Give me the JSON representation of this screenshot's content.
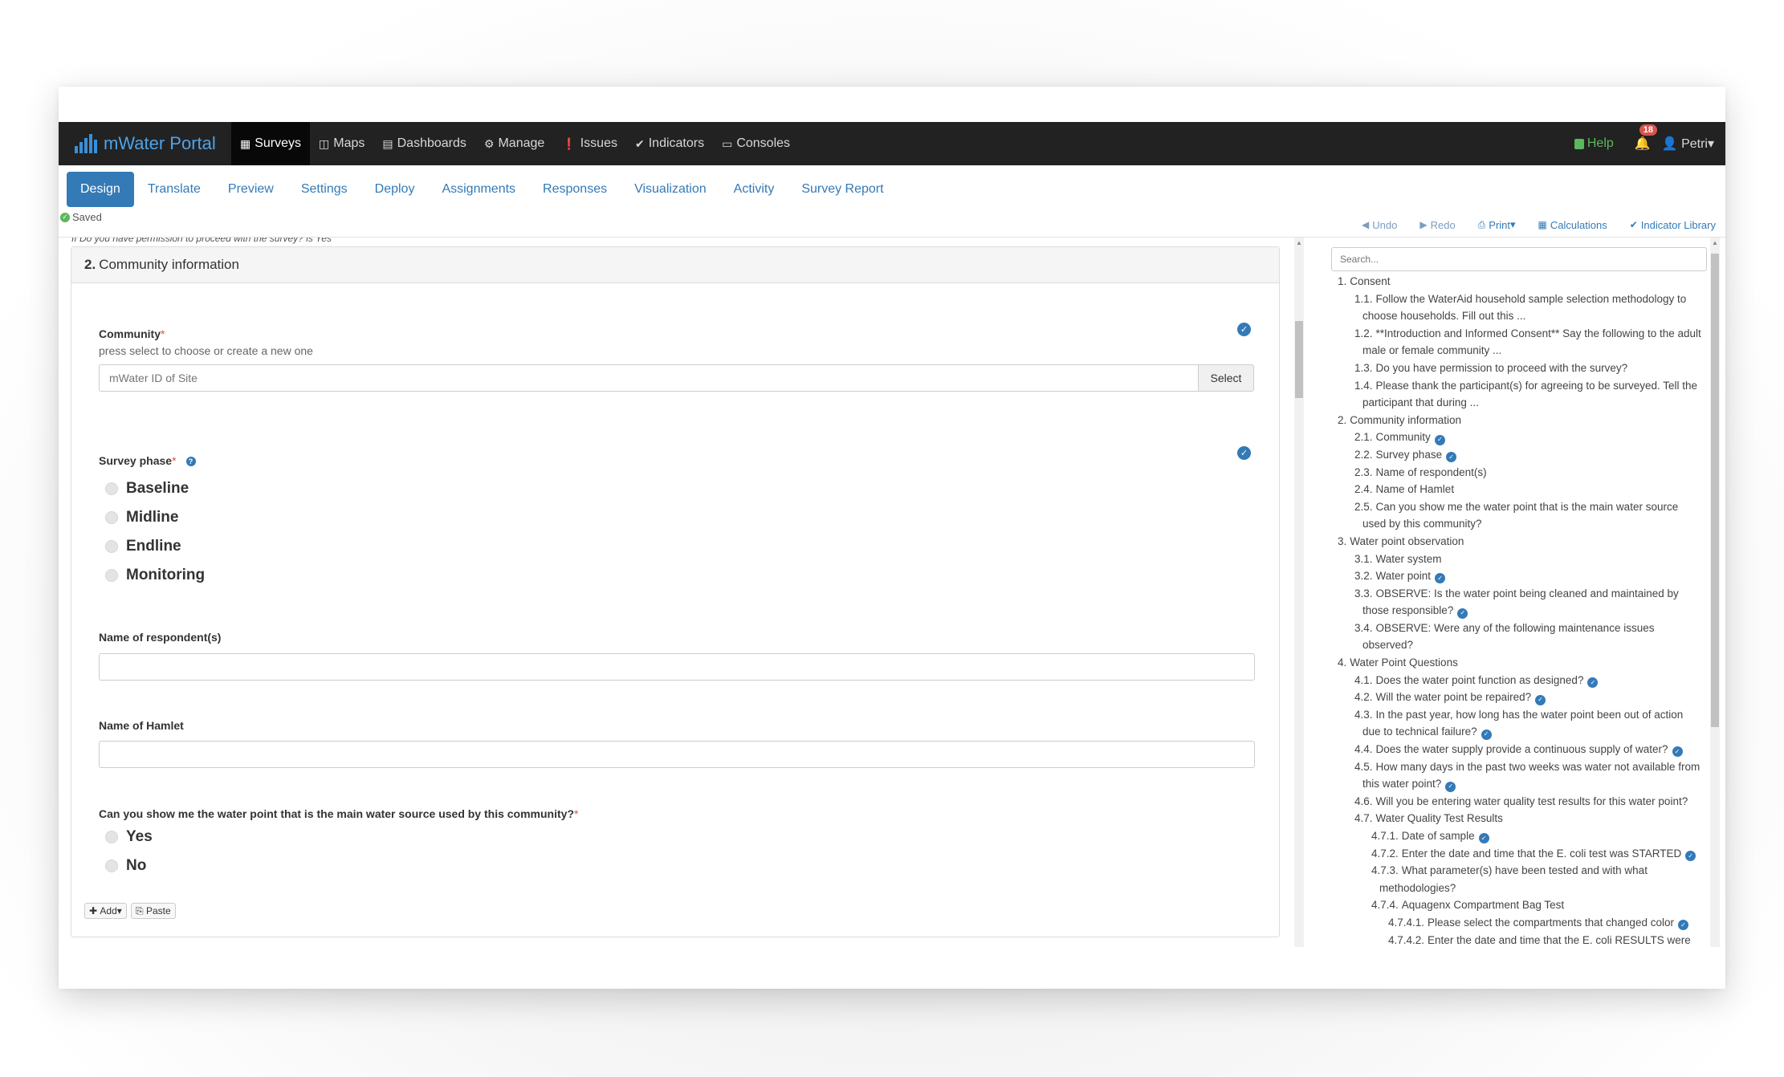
{
  "app": {
    "brand": "mWater Portal",
    "nav": [
      {
        "label": "Surveys",
        "icon": "table-icon"
      },
      {
        "label": "Maps",
        "icon": "map-icon"
      },
      {
        "label": "Dashboards",
        "icon": "bar-chart-icon"
      },
      {
        "label": "Manage",
        "icon": "gear-icon"
      },
      {
        "label": "Issues",
        "icon": "exclamation-icon"
      },
      {
        "label": "Indicators",
        "icon": "check-circle-icon"
      },
      {
        "label": "Consoles",
        "icon": "monitor-icon"
      }
    ],
    "help": "Help",
    "notifications_count": "18",
    "user": "Petri"
  },
  "tabs": [
    "Design",
    "Translate",
    "Preview",
    "Settings",
    "Deploy",
    "Assignments",
    "Responses",
    "Visualization",
    "Activity",
    "Survey Report"
  ],
  "status": "Saved",
  "toolbar": {
    "undo": "Undo",
    "redo": "Redo",
    "print": "Print",
    "calculations": "Calculations",
    "indicator_library": "Indicator Library"
  },
  "main": {
    "cut_text": "If Do you have permission to proceed with the survey? is Yes",
    "section": {
      "number": "2.",
      "title": "Community information"
    },
    "community": {
      "label": "Community",
      "hint": "press select to choose or create a new one",
      "placeholder": "mWater ID of Site",
      "select": "Select"
    },
    "phase": {
      "label": "Survey phase",
      "options": [
        "Baseline",
        "Midline",
        "Endline",
        "Monitoring"
      ]
    },
    "respondent": {
      "label": "Name of respondent(s)",
      "value": ""
    },
    "hamlet": {
      "label": "Name of Hamlet",
      "value": ""
    },
    "water_point": {
      "label": "Can you show me the water point that is the main water source used by this community?",
      "options": [
        "Yes",
        "No"
      ]
    },
    "add": "Add",
    "paste": "Paste"
  },
  "outline": {
    "search_placeholder": "Search...",
    "items": [
      {
        "n": "1.",
        "t": "Consent",
        "level": 1
      },
      {
        "n": "1.1.",
        "t": "Follow the WaterAid household sample selection methodology to",
        "t2": "choose households. Fill out this ...",
        "level": 2
      },
      {
        "n": "1.2.",
        "t": "**Introduction and Informed Consent** Say the following to the adult",
        "t2": "male or female community ...",
        "level": 2
      },
      {
        "n": "1.3.",
        "t": "Do you have permission to proceed with the survey?",
        "level": 2
      },
      {
        "n": "1.4.",
        "t": "Please thank the participant(s) for agreeing to be surveyed. Tell the",
        "t2": "participant that during ...",
        "level": 2
      },
      {
        "n": "2.",
        "t": "Community information",
        "level": 1
      },
      {
        "n": "2.1.",
        "t": "Community",
        "level": 2,
        "check": true
      },
      {
        "n": "2.2.",
        "t": "Survey phase",
        "level": 2,
        "check": true
      },
      {
        "n": "2.3.",
        "t": "Name of respondent(s)",
        "level": 2
      },
      {
        "n": "2.4.",
        "t": "Name of Hamlet",
        "level": 2
      },
      {
        "n": "2.5.",
        "t": "Can you show me the water point that is the main water source",
        "t2": "used by this community?",
        "level": 2
      },
      {
        "n": "3.",
        "t": "Water point observation",
        "level": 1
      },
      {
        "n": "3.1.",
        "t": "Water system",
        "level": 2
      },
      {
        "n": "3.2.",
        "t": "Water point",
        "level": 2,
        "check": true
      },
      {
        "n": "3.3.",
        "t": "OBSERVE: Is the water point being cleaned and maintained by",
        "t2": "those responsible?",
        "level": 2,
        "check2": true
      },
      {
        "n": "3.4.",
        "t": "OBSERVE: Were any of the following maintenance issues",
        "t2": "observed?",
        "level": 2
      },
      {
        "n": "4.",
        "t": "Water Point Questions",
        "level": 1
      },
      {
        "n": "4.1.",
        "t": "Does the water point function as designed?",
        "level": 2,
        "check": true
      },
      {
        "n": "4.2.",
        "t": "Will the water point be repaired?",
        "level": 2,
        "check": true
      },
      {
        "n": "4.3.",
        "t": "In the past year, how long has the water point been out of action",
        "t2": "due to technical failure?",
        "level": 2,
        "check2": true
      },
      {
        "n": "4.4.",
        "t": "Does the water supply provide a continuous supply of water?",
        "level": 2,
        "check": true
      },
      {
        "n": "4.5.",
        "t": "How many days in the past two weeks was water not available from",
        "t2": "this water point?",
        "level": 2,
        "check2": true
      },
      {
        "n": "4.6.",
        "t": "Will you be entering water quality test results for this water point?",
        "level": 2
      },
      {
        "n": "4.7.",
        "t": "Water Quality Test Results",
        "level": 2
      },
      {
        "n": "4.7.1.",
        "t": "Date of sample",
        "level": 3,
        "check": true
      },
      {
        "n": "4.7.2.",
        "t": "Enter the date and time that the E. coli test was STARTED",
        "level": 3,
        "check": true
      },
      {
        "n": "4.7.3.",
        "t": "What parameter(s) have been tested and with what",
        "t2": "methodologies?",
        "level": 3
      },
      {
        "n": "4.7.4.",
        "t": "Aquagenx Compartment Bag Test",
        "level": 3
      },
      {
        "n": "4.7.4.1.",
        "t": "Please select the compartments that changed color",
        "level": 4,
        "check": true
      },
      {
        "n": "4.7.4.2.",
        "t": "Enter the date and time that the E. coli RESULTS were",
        "level": 4
      }
    ]
  }
}
